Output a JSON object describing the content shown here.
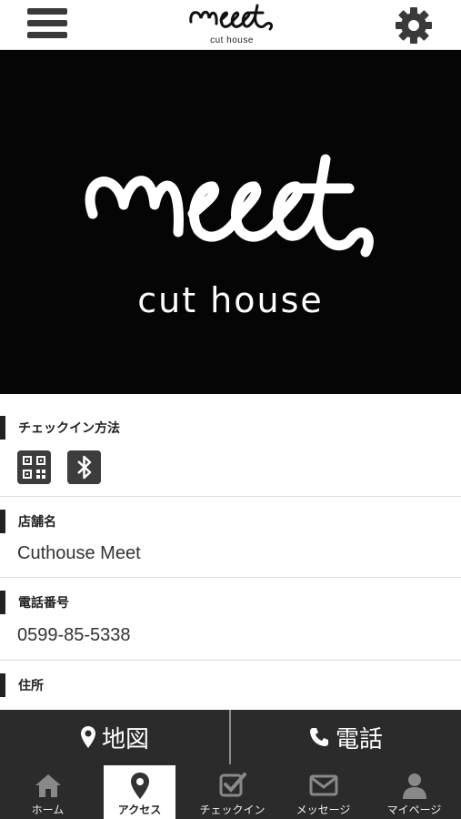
{
  "header": {
    "logo_script": "meet",
    "logo_sub": "cut house",
    "menu_icon": "hamburger-icon",
    "settings_icon": "gear-icon"
  },
  "hero": {
    "logo_script": "meet",
    "logo_sub": "cut house"
  },
  "sections": {
    "checkin": {
      "label": "チェックイン方法",
      "icons": [
        "qr-code-icon",
        "bluetooth-icon"
      ]
    },
    "store": {
      "label": "店舗名",
      "value": "Cuthouse Meet"
    },
    "phone": {
      "label": "電話番号",
      "value": "0599-85-5338"
    },
    "address": {
      "label": "住所"
    }
  },
  "actions": {
    "map_label": "地図",
    "call_label": "電話"
  },
  "tabs": [
    {
      "label": "ホーム",
      "icon": "home-icon"
    },
    {
      "label": "アクセス",
      "icon": "map-pin-icon",
      "active": true
    },
    {
      "label": "チェックイン",
      "icon": "checkbox-icon"
    },
    {
      "label": "メッセージ",
      "icon": "envelope-icon"
    },
    {
      "label": "マイページ",
      "icon": "person-icon"
    }
  ],
  "colors": {
    "dark_bar": "#2b2b2b",
    "hero_bg": "#050505",
    "accent": "#222222"
  }
}
